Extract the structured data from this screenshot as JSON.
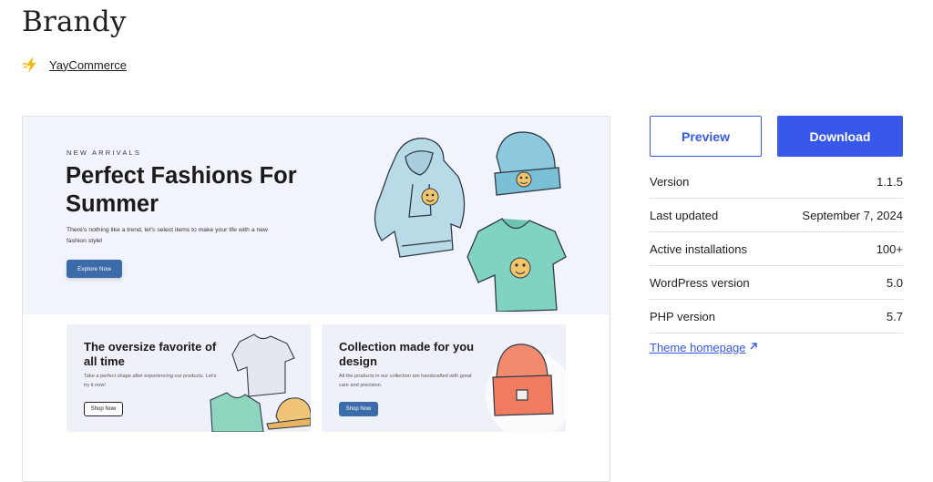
{
  "theme": {
    "title": "Brandy",
    "author": "YayCommerce"
  },
  "preview_image": {
    "hero": {
      "eyebrow": "NEW ARRIVALS",
      "heading": "Perfect Fashions For Summer",
      "description": "There's nothing like a trend, let's select items to make your life with a new fashion style!",
      "button": "Explore Now"
    },
    "cards": [
      {
        "title": "The oversize favorite of all time",
        "description": "Take a perfect shape after experiencing our products. Let's try it now!",
        "button": "Shop Now"
      },
      {
        "title": "Collection made for you design",
        "description": "All the products in our collection are handcrafted with great care and precision.",
        "button": "Shop Now"
      }
    ]
  },
  "actions": {
    "preview": "Preview",
    "download": "Download"
  },
  "meta": [
    {
      "label": "Version",
      "value": "1.1.5"
    },
    {
      "label": "Last updated",
      "value": "September 7, 2024"
    },
    {
      "label": "Active installations",
      "value": "100+"
    },
    {
      "label": "WordPress version",
      "value": "5.0"
    },
    {
      "label": "PHP version",
      "value": "5.7"
    }
  ],
  "homepage_link": "Theme homepage",
  "colors": {
    "accent": "#3858e9",
    "author_icon": "#f5b800",
    "preview_button": "#3b6ba8",
    "hero_bg": "#f2f4fb"
  },
  "icons": {
    "author": "lightning-bolt-icon",
    "external": "arrow-up-right-icon"
  }
}
